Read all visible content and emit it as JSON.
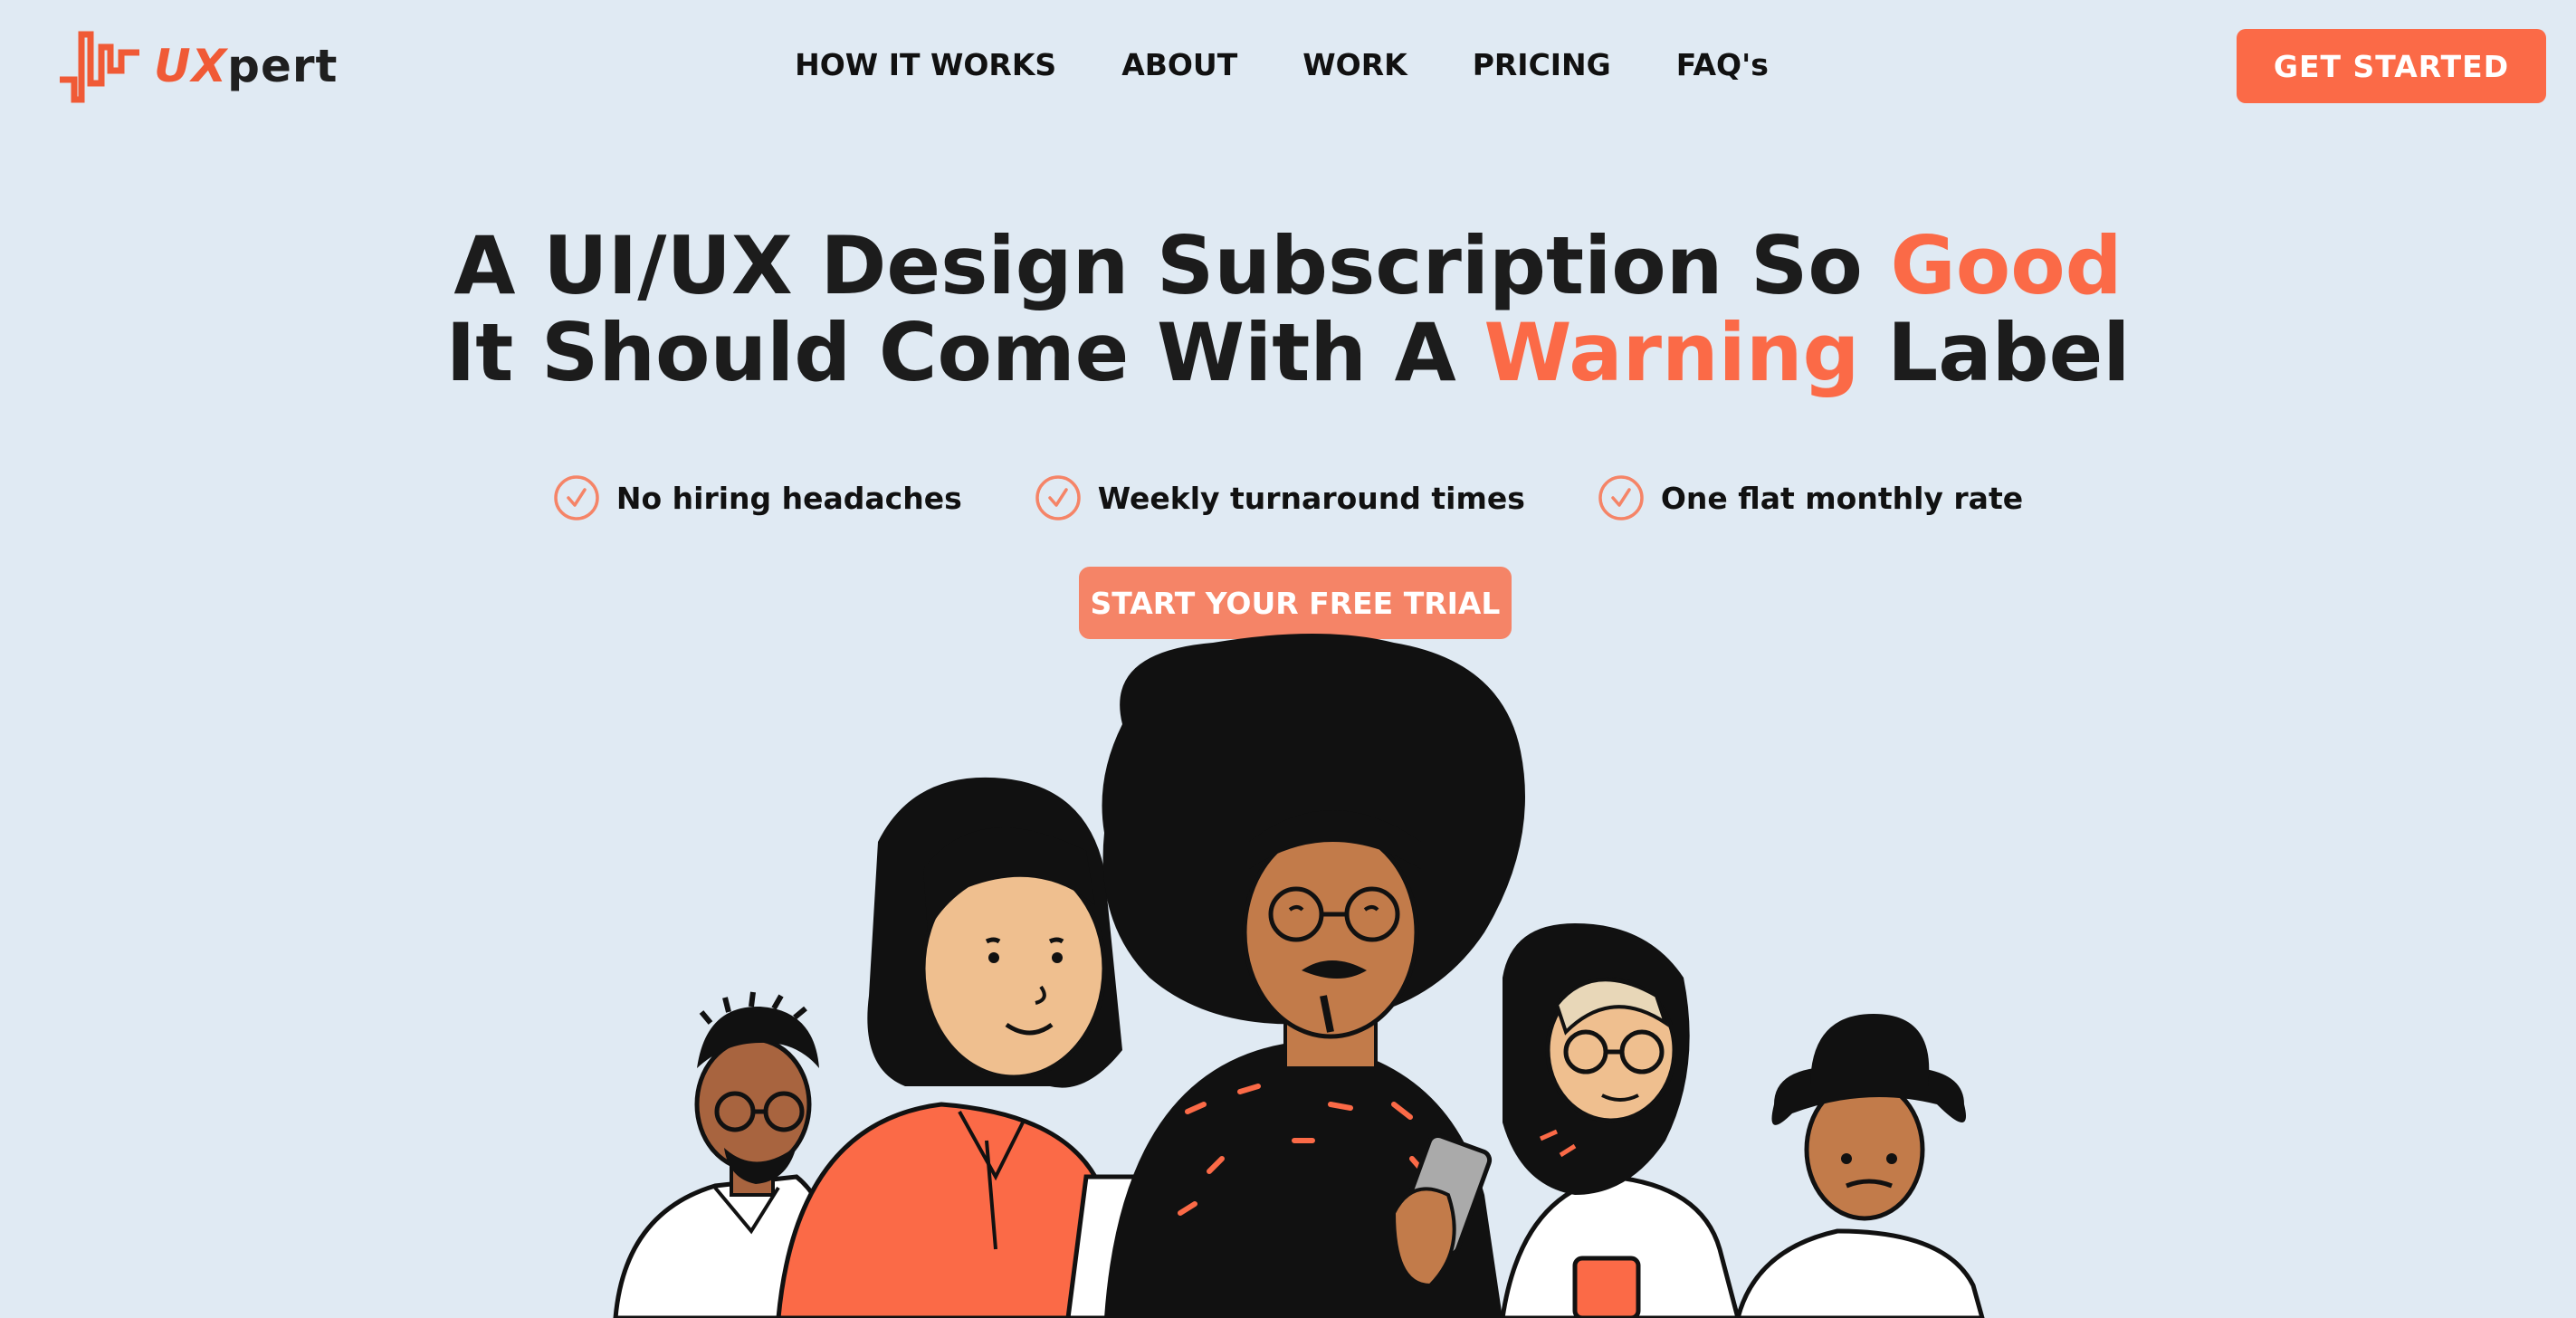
{
  "header": {
    "logo": {
      "accent_text": "UX",
      "rest_text": "pert"
    },
    "nav": [
      {
        "label": "HOW IT WORKS"
      },
      {
        "label": "ABOUT"
      },
      {
        "label": "WORK"
      },
      {
        "label": "PRICING"
      },
      {
        "label": "FAQ's"
      }
    ],
    "cta_label": "GET STARTED"
  },
  "hero": {
    "headline": {
      "line1_prefix": "A UI/UX Design Subscription So ",
      "line1_accent": "Good",
      "line2_prefix": "It Should Come With A ",
      "line2_accent": "Warning",
      "line2_suffix": " Label"
    },
    "benefits": [
      {
        "label": "No hiring headaches",
        "icon": "check-circle-icon"
      },
      {
        "label": "Weekly turnaround times",
        "icon": "check-circle-icon"
      },
      {
        "label": "One flat monthly rate",
        "icon": "check-circle-icon"
      }
    ],
    "trial_button_label": "START YOUR FREE TRIAL"
  },
  "colors": {
    "background": "#e0eaf3",
    "accent": "#fb6a47",
    "trial_button": "#f58467",
    "text": "#1c1c1c"
  }
}
